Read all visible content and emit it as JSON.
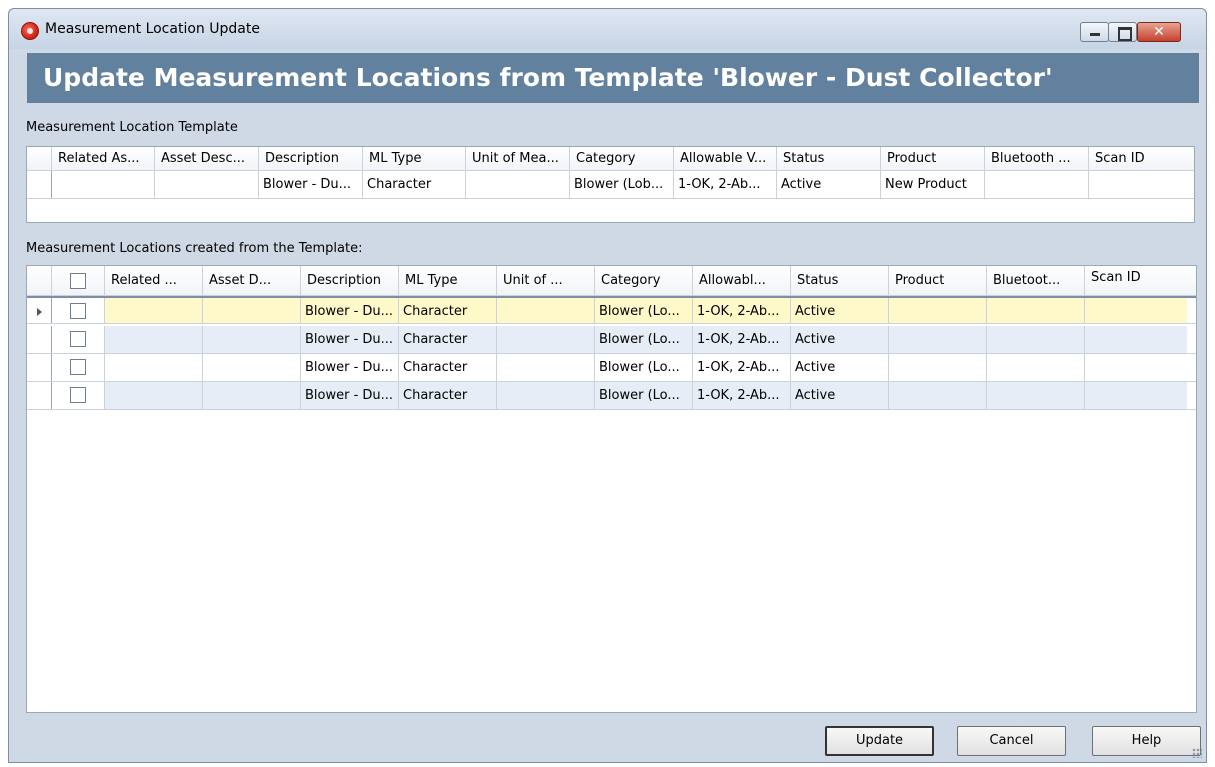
{
  "window": {
    "title": "Measurement Location Update"
  },
  "banner": {
    "title": "Update Measurement Locations from Template 'Blower - Dust Collector'"
  },
  "template_section": {
    "label": "Measurement Location Template",
    "columns": [
      "Related As...",
      "Asset Desc...",
      "Description",
      "ML Type",
      "Unit of Mea...",
      "Category",
      "Allowable V...",
      "Status",
      "Product",
      "Bluetooth ...",
      "Scan ID"
    ],
    "rows": [
      [
        "",
        "",
        "Blower - Du...",
        "Character",
        "",
        "Blower (Lob...",
        "1-OK, 2-Ab...",
        "Active",
        "New Product",
        "",
        ""
      ]
    ]
  },
  "locations_section": {
    "label": "Measurement Locations created from the Template:",
    "columns": [
      "Related ...",
      "Asset D...",
      "Description",
      "ML Type",
      "Unit of ...",
      "Category",
      "Allowabl...",
      "Status",
      "Product",
      "Bluetoot...",
      "Scan ID"
    ],
    "rows": [
      [
        "",
        "",
        "Blower - Du...",
        "Character",
        "",
        "Blower (Lo...",
        "1-OK, 2-Ab...",
        "Active",
        "",
        "",
        ""
      ],
      [
        "",
        "",
        "Blower - Du...",
        "Character",
        "",
        "Blower (Lo...",
        "1-OK, 2-Ab...",
        "Active",
        "",
        "",
        ""
      ],
      [
        "",
        "",
        "Blower - Du...",
        "Character",
        "",
        "Blower (Lo...",
        "1-OK, 2-Ab...",
        "Active",
        "",
        "",
        ""
      ],
      [
        "",
        "",
        "Blower - Du...",
        "Character",
        "",
        "Blower (Lo...",
        "1-OK, 2-Ab...",
        "Active",
        "",
        "",
        ""
      ]
    ]
  },
  "buttons": {
    "update": "Update",
    "cancel": "Cancel",
    "help": "Help"
  },
  "colors": {
    "banner": "#62819f",
    "selected_row": "#fff8c8",
    "alt_row": "#e6edf6",
    "dialog_bg": "#cfd9e6"
  }
}
